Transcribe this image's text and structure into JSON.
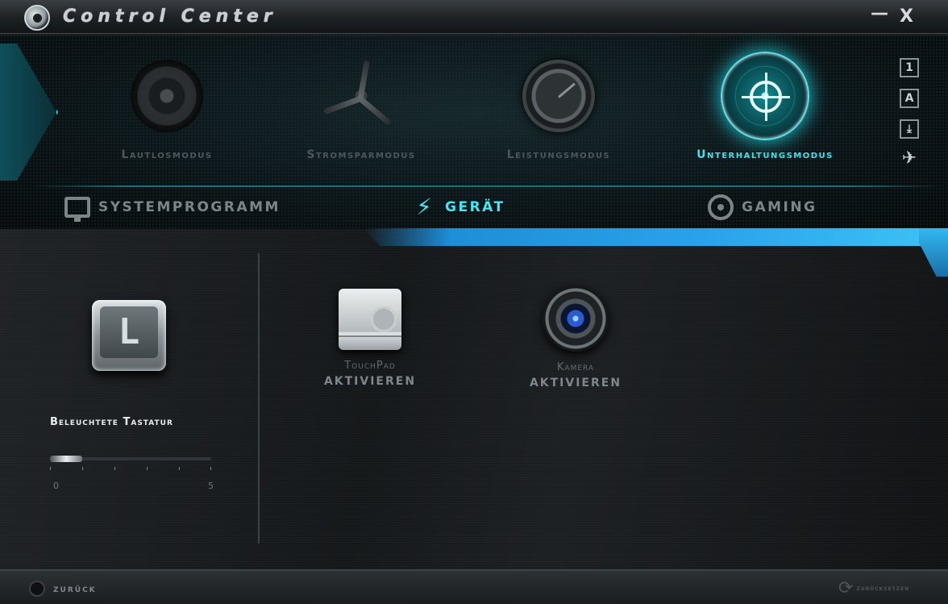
{
  "window": {
    "title": "Control Center",
    "minimize_label": "—",
    "close_label": "X"
  },
  "modes": [
    {
      "label": "Lautlosmodus",
      "icon": "speaker-icon",
      "active": false
    },
    {
      "label": "Stromsparmodus",
      "icon": "fan-icon",
      "active": false
    },
    {
      "label": "Leistungsmodus",
      "icon": "gauge-icon",
      "active": false
    },
    {
      "label": "Unterhaltungsmodus",
      "icon": "target-icon",
      "active": true
    }
  ],
  "side_icons": [
    {
      "label": "1",
      "icon": "numlock-icon"
    },
    {
      "label": "A",
      "icon": "capslock-icon"
    },
    {
      "label": "⤓",
      "icon": "scroll-lock-icon"
    },
    {
      "label": "✈",
      "icon": "airplane-mode-icon"
    }
  ],
  "tabs": [
    {
      "label": "SYSTEMPROGRAMM",
      "icon": "monitor-icon",
      "active": false
    },
    {
      "label": "GERÄT",
      "icon": "plug-icon",
      "active": true
    },
    {
      "label": "GAMING",
      "icon": "steering-wheel-icon",
      "active": false
    }
  ],
  "keyboard": {
    "key_letter": "L",
    "label": "Beleuchtete Tastatur",
    "slider_min": "0",
    "slider_max": "5",
    "level": 1
  },
  "devices": [
    {
      "name": "TouchPad",
      "action": "AKTIVIEREN",
      "icon": "touchpad-icon"
    },
    {
      "name": "Kamera",
      "action": "AKTIVIEREN",
      "icon": "camera-icon"
    }
  ],
  "footer": {
    "back_label": "zurück",
    "reset_label": "zurücksetzen",
    "reset_icon": "⟳"
  },
  "colors": {
    "accent": "#3fe3ef",
    "accent_blue": "#2aa3ec",
    "inactive_text": "#4e5659"
  }
}
